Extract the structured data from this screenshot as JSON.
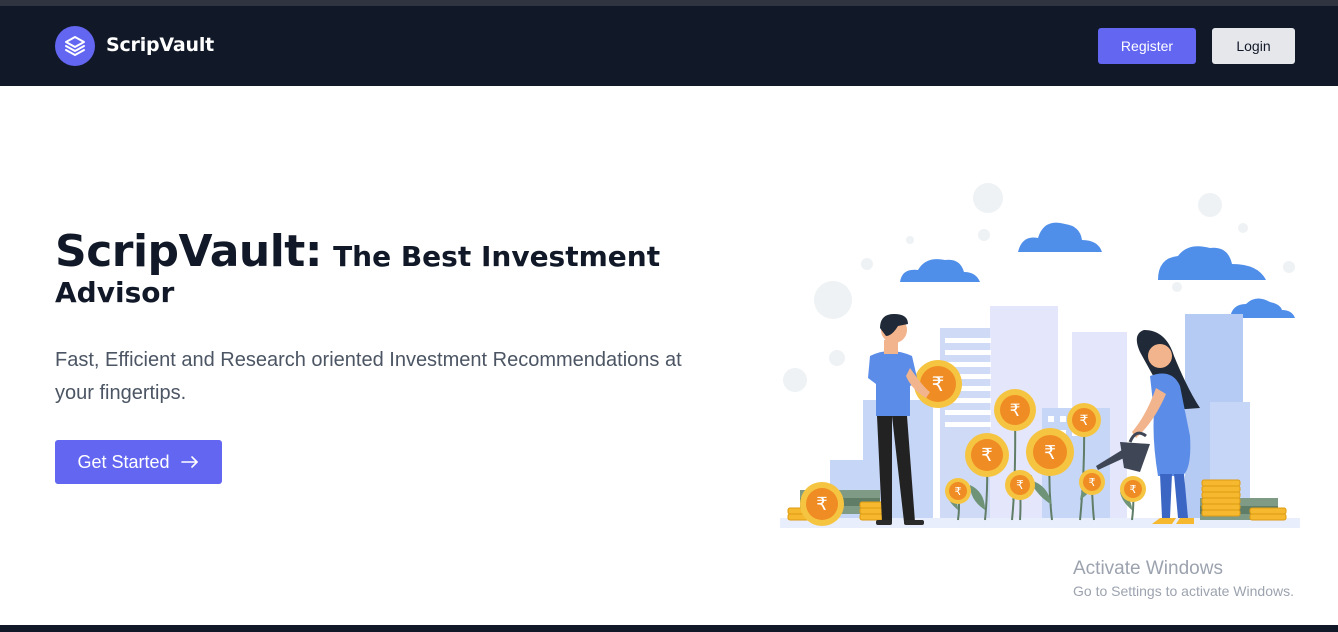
{
  "navbar": {
    "brand": "ScripVault",
    "logo_icon": "layers-icon",
    "register_label": "Register",
    "login_label": "Login"
  },
  "hero": {
    "title_main": "ScripVault:",
    "title_rest": "The Best Investment",
    "title_line2": "Advisor",
    "subtitle": "Fast, Efficient and Research oriented Investment Recommendations at your fingertips.",
    "cta_label": "Get Started",
    "cta_icon": "arrow-right-icon",
    "currency_symbol": "₹"
  },
  "watermark": {
    "line1": "Activate Windows",
    "line2": "Go to Settings to activate Windows."
  },
  "colors": {
    "navbar_bg": "#111827",
    "accent": "#6366f1",
    "login_bg": "#e5e7eb",
    "coin": "#f5b82e"
  }
}
